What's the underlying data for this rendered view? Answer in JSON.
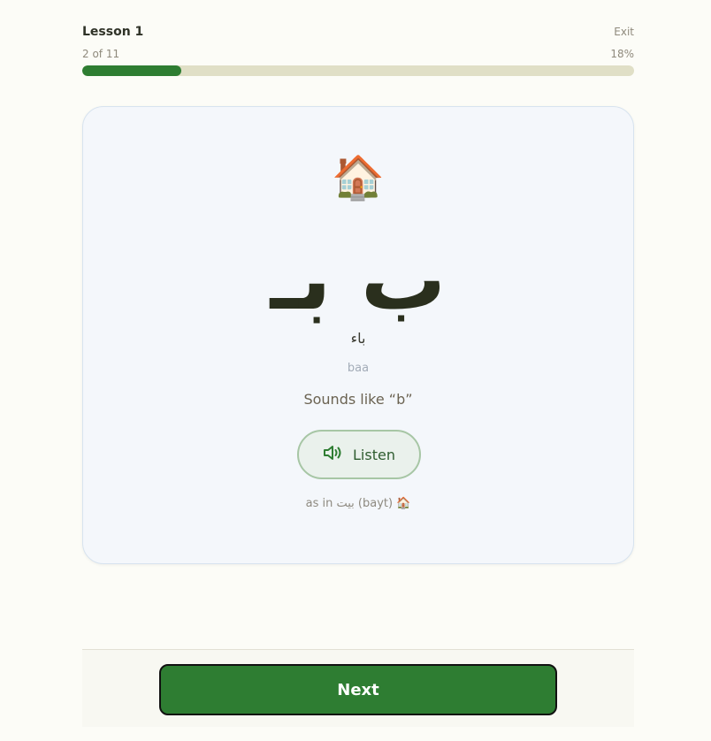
{
  "header": {
    "lesson_title": "Lesson 1",
    "exit_label": "Exit",
    "progress_label": "2 of 11",
    "progress_percent_label": "18%",
    "progress_fraction": 0.18
  },
  "card": {
    "emoji": "🏠",
    "letter_forms": "ب بـ",
    "letter_name": "باء",
    "transliteration": "baa",
    "sounds_like": "Sounds like “b”",
    "listen_label": "Listen",
    "example": "as in بيت (bayt) 🏠"
  },
  "footer": {
    "next_label": "Next"
  },
  "colors": {
    "accent": "#2e7d32",
    "progress_track": "#e0dfc6",
    "card_bg": "#f4f7fb"
  },
  "icons": {
    "listen": "speaker-icon"
  }
}
